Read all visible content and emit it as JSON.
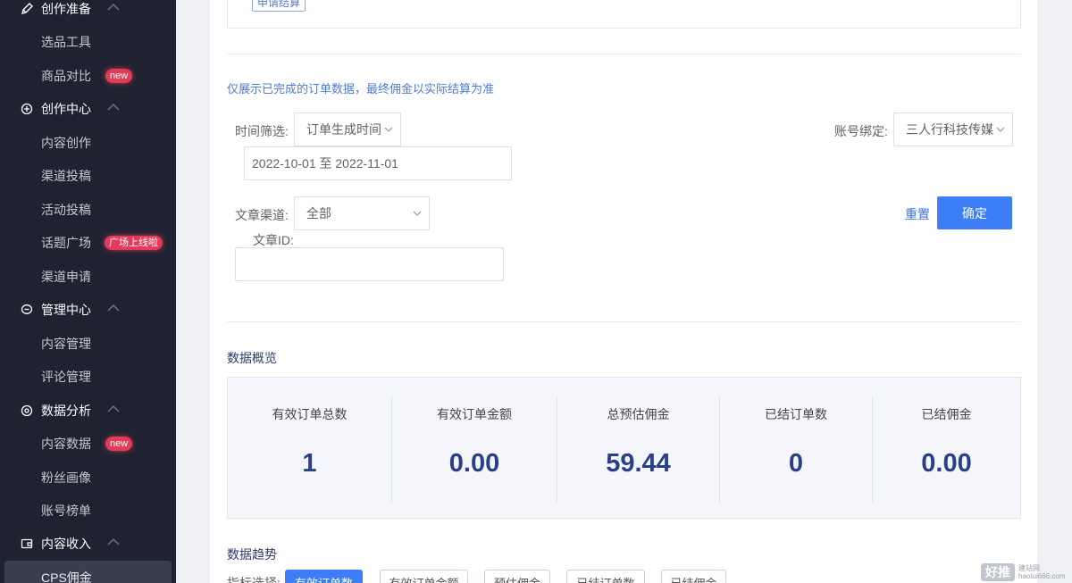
{
  "sidebar": {
    "groups": [
      {
        "label": "创作准备",
        "icon": "pencil-icon"
      },
      {
        "label": "创作中心",
        "icon": "plus-circle-icon"
      },
      {
        "label": "管理中心",
        "icon": "chat-bubble-icon"
      },
      {
        "label": "数据分析",
        "icon": "target-icon"
      },
      {
        "label": "内容收入",
        "icon": "wallet-icon"
      }
    ],
    "items": [
      {
        "label": "选品工具"
      },
      {
        "label": "商品对比",
        "badge": "new"
      },
      {
        "label": "内容创作"
      },
      {
        "label": "渠道投稿"
      },
      {
        "label": "活动投稿"
      },
      {
        "label": "话题广场",
        "badge": "广场上线啦"
      },
      {
        "label": "渠道申请"
      },
      {
        "label": "内容管理"
      },
      {
        "label": "评论管理"
      },
      {
        "label": "内容数据",
        "badge": "new"
      },
      {
        "label": "粉丝画像"
      },
      {
        "label": "账号榜单"
      },
      {
        "label": "CPS佣金"
      }
    ]
  },
  "top": {
    "apply_label": "申请结算"
  },
  "notice": "仅展示已完成的订单数据，最终佣金以实际结算为准",
  "filters": {
    "time_label": "时间筛选:",
    "time_type": "订单生成时间",
    "date_range": "2022-10-01 至 2022-11-01",
    "account_label": "账号绑定:",
    "account_value": "三人行科技传媒",
    "channel_label": "文章渠道:",
    "channel_value": "全部",
    "article_id_label": "文章ID:",
    "article_id_value": "",
    "reset_label": "重置",
    "confirm_label": "确定"
  },
  "overview": {
    "title": "数据概览",
    "stats": [
      {
        "label": "有效订单总数",
        "value": "1"
      },
      {
        "label": "有效订单金额",
        "value": "0.00"
      },
      {
        "label": "总预估佣金",
        "value": "59.44"
      },
      {
        "label": "已结订单数",
        "value": "0"
      },
      {
        "label": "已结佣金",
        "value": "0.00"
      }
    ]
  },
  "trend": {
    "title": "数据趋势",
    "indicator_label": "指标选择:",
    "chips": [
      "有效订单数",
      "有效订单金额",
      "预估佣金",
      "已结订单数",
      "已结佣金"
    ]
  },
  "watermark": {
    "logo": "好推",
    "line1": "建站网",
    "line2": "haotui666.com"
  }
}
